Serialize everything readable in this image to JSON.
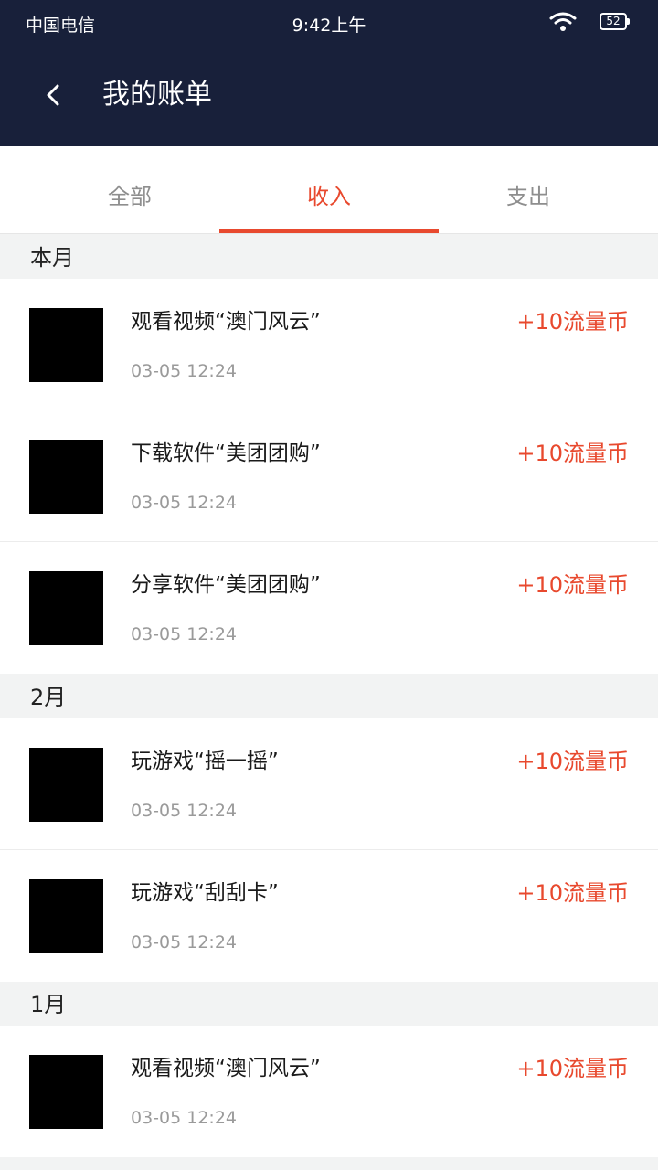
{
  "status_bar": {
    "carrier": "中国电信",
    "time": "9:42上午",
    "battery": "52"
  },
  "header": {
    "title": "我的账单"
  },
  "tabs": [
    {
      "label": "全部",
      "active": false
    },
    {
      "label": "收入",
      "active": true
    },
    {
      "label": "支出",
      "active": false
    }
  ],
  "sections": [
    {
      "title": "本月",
      "items": [
        {
          "title": "观看视频“澳门风云”",
          "time": "03-05 12:24",
          "amount": "+10流量币"
        },
        {
          "title": "下载软件“美团团购”",
          "time": "03-05 12:24",
          "amount": "+10流量币"
        },
        {
          "title": "分享软件“美团团购”",
          "time": "03-05 12:24",
          "amount": "+10流量币"
        }
      ]
    },
    {
      "title": "2月",
      "items": [
        {
          "title": "玩游戏“摇一摇”",
          "time": "03-05 12:24",
          "amount": "+10流量币"
        },
        {
          "title": "玩游戏“刮刮卡”",
          "time": "03-05 12:24",
          "amount": "+10流量币"
        }
      ]
    },
    {
      "title": "1月",
      "items": [
        {
          "title": "观看视频“澳门风云”",
          "time": "03-05 12:24",
          "amount": "+10流量币"
        }
      ]
    }
  ],
  "colors": {
    "header_bg": "#18203a",
    "accent": "#e8492e",
    "section_bg": "#f2f3f3"
  }
}
